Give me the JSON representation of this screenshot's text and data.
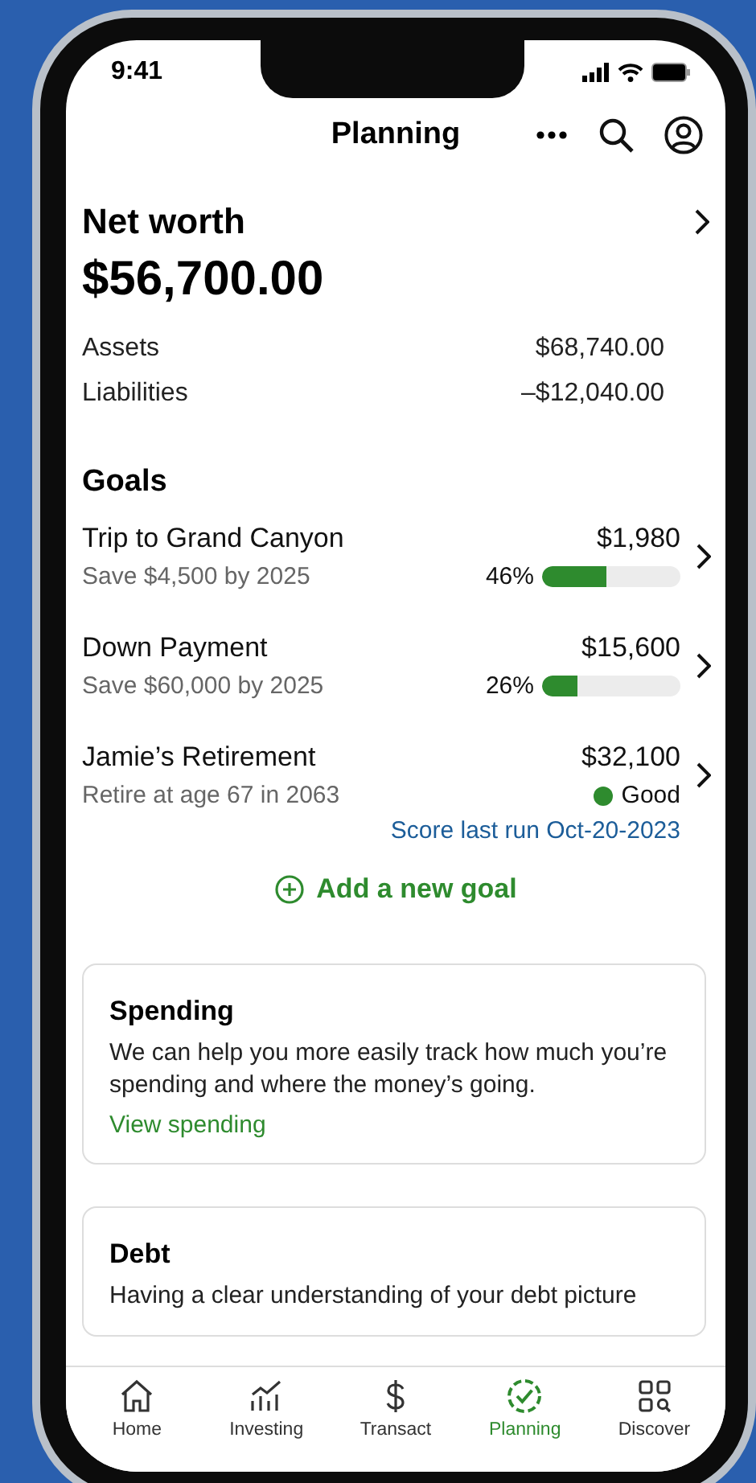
{
  "status_bar": {
    "time": "9:41"
  },
  "header": {
    "title": "Planning"
  },
  "net_worth": {
    "title": "Net worth",
    "amount": "$56,700.00",
    "rows": [
      {
        "label": "Assets",
        "value": "$68,740.00"
      },
      {
        "label": "Liabilities",
        "value": "–$12,040.00"
      }
    ]
  },
  "goals": {
    "title": "Goals",
    "items": [
      {
        "kind": "progress",
        "name": "Trip to Grand Canyon",
        "amount": "$1,980",
        "detail": "Save $4,500 by 2025",
        "percent": "46%",
        "level": 0.46
      },
      {
        "kind": "progress",
        "name": "Down Payment",
        "amount": "$15,600",
        "detail": "Save $60,000 by 2025",
        "percent": "26%",
        "level": 0.26
      },
      {
        "kind": "status",
        "name": "Jamie’s Retirement",
        "amount": "$32,100",
        "detail": "Retire at age 67 in 2063",
        "status": "Good",
        "color": "#2e8b2e",
        "note": "Score last run Oct-20-2023"
      }
    ],
    "add_label": "Add a new goal"
  },
  "cards": [
    {
      "title": "Spending",
      "body": "We can help you more easily track how much you’re spending and where the money’s going.",
      "link": "View spending"
    },
    {
      "title": "Debt",
      "body": "Having a clear understanding of your debt picture"
    }
  ],
  "tabs": [
    {
      "label": "Home",
      "selected": false
    },
    {
      "label": "Investing",
      "selected": false
    },
    {
      "label": "Transact",
      "selected": false
    },
    {
      "label": "Planning",
      "selected": true
    },
    {
      "label": "Discover",
      "selected": false
    }
  ]
}
